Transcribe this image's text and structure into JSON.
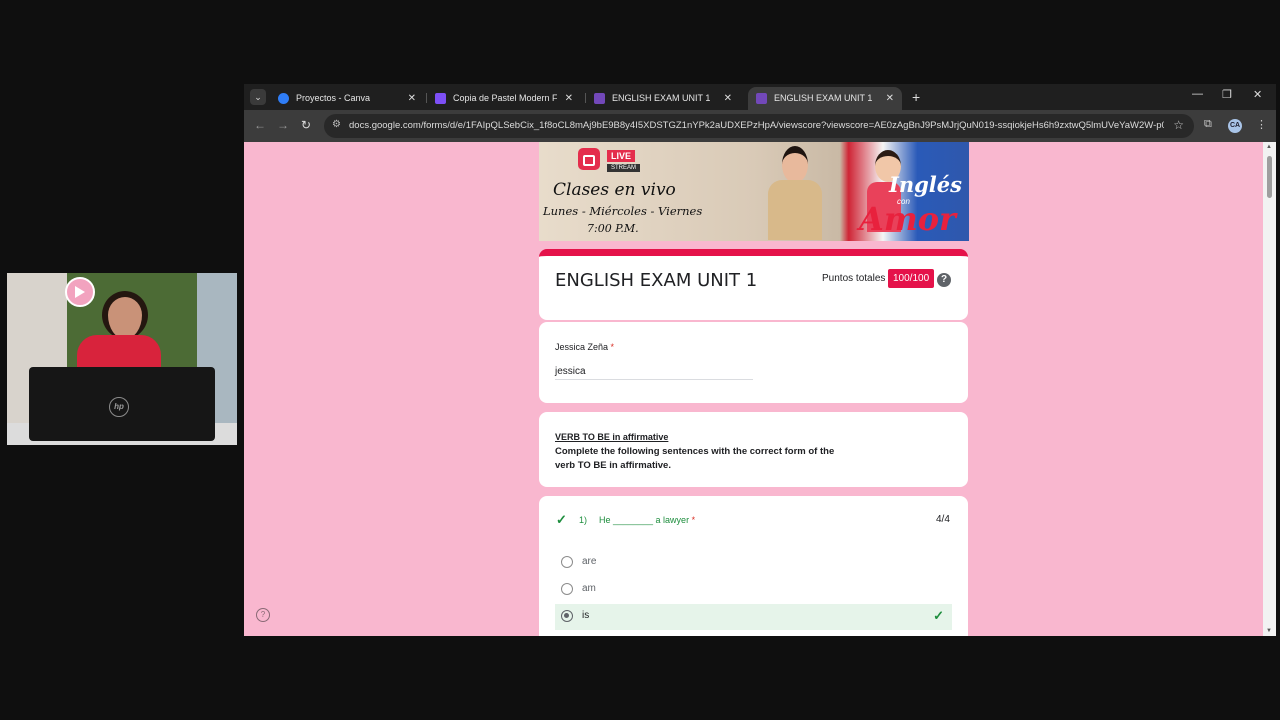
{
  "browser": {
    "tabs": [
      {
        "title": "Proyectos - Canva",
        "favicon_color": "#2f7df6",
        "active": false
      },
      {
        "title": "Copia de Pastel Modern Funny",
        "favicon_color": "#7d4ff5",
        "active": false
      },
      {
        "title": "ENGLISH EXAM UNIT 1",
        "favicon_color": "#7248b9",
        "active": false
      },
      {
        "title": "ENGLISH EXAM UNIT 1",
        "favicon_color": "#7248b9",
        "active": true
      }
    ],
    "url": "docs.google.com/forms/d/e/1FAIpQLSebCix_1f8oCL8mAj9bE9B8y4I5XDSTGZ1nYPk2aUDXEPzHpA/viewscore?viewscore=AE0zAgBnJ9PsMJrjQuN019-ssqiokjeHs6h9zxtwQ5lmUVeYaW2W-p0BAtB6...",
    "profile_initials": "CA"
  },
  "banner": {
    "live": "LIVE",
    "stream": "STREAM",
    "line1": "Clases en vivo",
    "line2": "Lunes - Miércoles - Viernes",
    "line3": "7:00 P.M.",
    "brand_top": "Inglés",
    "brand_con": "con",
    "brand_amor": "Amor"
  },
  "form": {
    "title": "ENGLISH EXAM UNIT 1",
    "points_label": "Puntos totales",
    "points_value": "100/100",
    "accent_color": "#e5124a",
    "name_question": "Jessica Zeña",
    "required_mark": "*",
    "name_answer": "jessica",
    "section_title": "VERB TO BE in affirmative",
    "section_description": "Complete the following sentences with the correct form of the verb TO BE in affirmative.",
    "question1": {
      "number": "1)",
      "text": "He ________ a lawyer",
      "score": "4/4",
      "options": [
        {
          "label": "are",
          "selected": false,
          "correct": false
        },
        {
          "label": "am",
          "selected": false,
          "correct": false
        },
        {
          "label": "is",
          "selected": true,
          "correct": true
        }
      ]
    }
  }
}
